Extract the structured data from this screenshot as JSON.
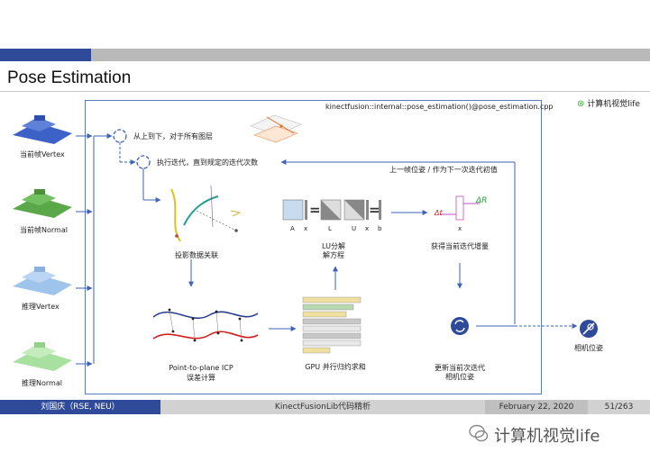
{
  "slide": {
    "title": "Pose Estimation",
    "source_ref": "kinectfusion::internal::pose_estimation()@pose_estimation.cpp",
    "brand": "计算机视觉life"
  },
  "inputs": [
    {
      "label": "当前帧Vertex"
    },
    {
      "label": "当前帧Normal"
    },
    {
      "label": "推理Vertex"
    },
    {
      "label": "推理Normal"
    }
  ],
  "loops": {
    "outer": "从上到下，对于所有图层",
    "inner": "执行迭代，直到规定的迭代次数"
  },
  "feedback_label": "上一帧位姿 / 作为下一次迭代初值",
  "steps": {
    "projection": "投影数据关联",
    "icp_line1": "Point-to-plane ICP",
    "icp_line2": "误差计算",
    "gpu_sum": "GPU 并行归约求和",
    "lu_line1": "LU分解",
    "lu_line2": "解方程",
    "increment": "获得当前迭代增量",
    "update_line1": "更新当前次迭代",
    "update_line2": "相机位姿",
    "output": "相机位姿"
  },
  "lu_symbols": {
    "a": "A",
    "x": "x",
    "l": "L",
    "u": "U",
    "x2": "x",
    "b": "b",
    "eq": "="
  },
  "delta": {
    "r": "ΔR",
    "t": "Δt",
    "x": "x"
  },
  "footer": {
    "author": "刘国庆（RSE, NEU）",
    "course": "KinectFusionLib代码精析",
    "date": "February 22, 2020",
    "page": "51/263"
  },
  "watermark": "计算机视觉life",
  "colors": {
    "accent_blue": "#2e4a99",
    "frame_blue": "#5d7bb8",
    "vertex_blue": "#3c62c8",
    "normal_green": "#5aa84a",
    "pred_vertex_blue": "#9fc4ec",
    "pred_normal_green": "#a8e0a0"
  }
}
